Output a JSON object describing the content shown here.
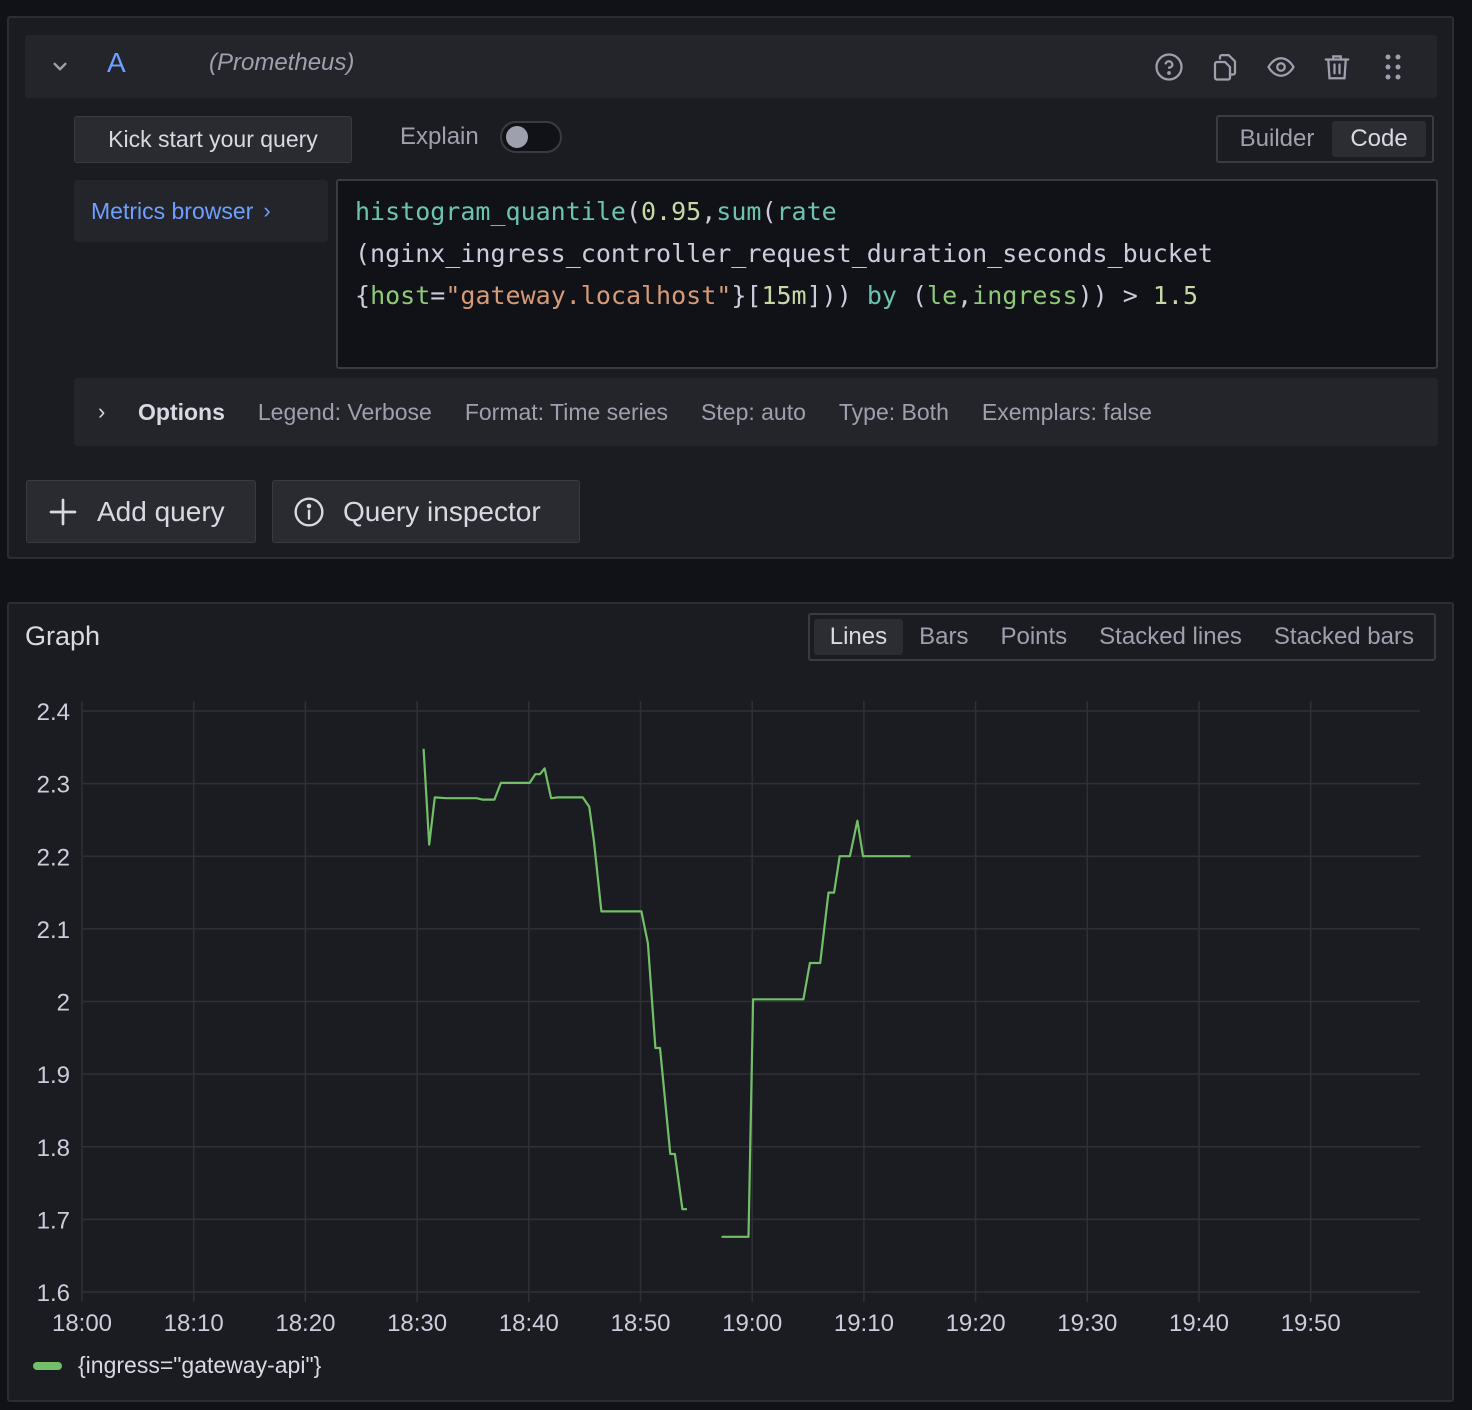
{
  "query": {
    "ref_id": "A",
    "datasource": "(Prometheus)",
    "header_icons": [
      "help-icon",
      "copy-icon",
      "eye-icon",
      "trash-icon",
      "drag-handle-icon"
    ],
    "kick_start_label": "Kick start your query",
    "explain_label": "Explain",
    "explain_enabled": false,
    "modes": [
      "Builder",
      "Code"
    ],
    "active_mode": "Code",
    "metrics_browser_label": "Metrics browser",
    "code_lines": [
      [
        {
          "t": "histogram_quantile",
          "c": "fn"
        },
        {
          "t": "(",
          "c": "punc"
        },
        {
          "t": "0.95",
          "c": "num"
        },
        {
          "t": ",",
          "c": "punc"
        },
        {
          "t": "sum",
          "c": "fn"
        },
        {
          "t": "(",
          "c": "punc"
        },
        {
          "t": "rate",
          "c": "fn"
        }
      ],
      [
        {
          "t": "(nginx_ingress_controller_request_duration_seconds_bucket",
          "c": "punc"
        }
      ],
      [
        {
          "t": "{",
          "c": "punc"
        },
        {
          "t": "host",
          "c": "label"
        },
        {
          "t": "=",
          "c": "punc"
        },
        {
          "t": "\"gateway.localhost\"",
          "c": "str"
        },
        {
          "t": "}",
          "c": "punc"
        },
        {
          "t": "[",
          "c": "punc"
        },
        {
          "t": "15m",
          "c": "num"
        },
        {
          "t": "])) ",
          "c": "punc"
        },
        {
          "t": "by",
          "c": "kw"
        },
        {
          "t": " (",
          "c": "punc"
        },
        {
          "t": "le",
          "c": "label"
        },
        {
          "t": ",",
          "c": "punc"
        },
        {
          "t": "ingress",
          "c": "label"
        },
        {
          "t": ")) > ",
          "c": "punc"
        },
        {
          "t": "1.5",
          "c": "num"
        }
      ]
    ],
    "options": {
      "title": "Options",
      "items": [
        "Legend: Verbose",
        "Format: Time series",
        "Step: auto",
        "Type: Both",
        "Exemplars: false"
      ]
    }
  },
  "actions": {
    "add_query": "Add query",
    "query_inspector": "Query inspector"
  },
  "graph": {
    "title": "Graph",
    "types": [
      "Lines",
      "Bars",
      "Points",
      "Stacked lines",
      "Stacked bars"
    ],
    "active_type": "Lines"
  },
  "chart_data": {
    "type": "line",
    "title": "Graph",
    "xlabel": "",
    "ylabel": "",
    "x_ticks": [
      "18:00",
      "18:10",
      "18:20",
      "18:30",
      "18:40",
      "18:50",
      "19:00",
      "19:10",
      "19:20",
      "19:30",
      "19:40",
      "19:50"
    ],
    "x_range_minutes_after_1800": [
      0,
      120
    ],
    "y_ticks": [
      2.4,
      2.3,
      2.2,
      2.1,
      2,
      1.9,
      1.8,
      1.7,
      1.6
    ],
    "ylim": [
      1.6,
      2.4
    ],
    "grid": true,
    "legend_position": "bottom-left",
    "series": [
      {
        "name": "{ingress=\"gateway-api\"}",
        "color": "#73bf69",
        "segments": [
          [
            {
              "x": "18:30:35",
              "y": 2.348
            },
            {
              "x": "18:31:05",
              "y": 2.216
            },
            {
              "x": "18:31:35",
              "y": 2.281
            },
            {
              "x": "18:32:35",
              "y": 2.28
            },
            {
              "x": "18:35:20",
              "y": 2.28
            },
            {
              "x": "18:35:50",
              "y": 2.278
            },
            {
              "x": "18:36:55",
              "y": 2.278
            },
            {
              "x": "18:37:30",
              "y": 2.301
            },
            {
              "x": "18:40:05",
              "y": 2.301
            },
            {
              "x": "18:40:35",
              "y": 2.313
            },
            {
              "x": "18:41:00",
              "y": 2.313
            },
            {
              "x": "18:41:25",
              "y": 2.321
            },
            {
              "x": "18:42:00",
              "y": 2.28
            },
            {
              "x": "18:42:35",
              "y": 2.281
            },
            {
              "x": "18:44:50",
              "y": 2.281
            },
            {
              "x": "18:45:25",
              "y": 2.268
            },
            {
              "x": "18:45:50",
              "y": 2.22
            },
            {
              "x": "18:46:30",
              "y": 2.124
            },
            {
              "x": "18:50:05",
              "y": 2.124
            },
            {
              "x": "18:50:40",
              "y": 2.08
            },
            {
              "x": "18:51:20",
              "y": 1.936
            },
            {
              "x": "18:51:45",
              "y": 1.936
            },
            {
              "x": "18:52:40",
              "y": 1.79
            },
            {
              "x": "18:53:05",
              "y": 1.79
            },
            {
              "x": "18:53:45",
              "y": 1.714
            },
            {
              "x": "18:54:10",
              "y": 1.714
            }
          ],
          [
            {
              "x": "18:57:15",
              "y": 1.676
            },
            {
              "x": "18:59:40",
              "y": 1.676
            },
            {
              "x": "19:00:05",
              "y": 2.003
            },
            {
              "x": "19:04:35",
              "y": 2.003
            },
            {
              "x": "19:05:10",
              "y": 2.053
            },
            {
              "x": "19:06:05",
              "y": 2.053
            },
            {
              "x": "19:06:50",
              "y": 2.15
            },
            {
              "x": "19:07:20",
              "y": 2.15
            },
            {
              "x": "19:07:50",
              "y": 2.2
            },
            {
              "x": "19:08:45",
              "y": 2.2
            },
            {
              "x": "19:09:25",
              "y": 2.249
            },
            {
              "x": "19:09:55",
              "y": 2.2
            },
            {
              "x": "19:14:10",
              "y": 2.2
            }
          ]
        ]
      }
    ]
  }
}
